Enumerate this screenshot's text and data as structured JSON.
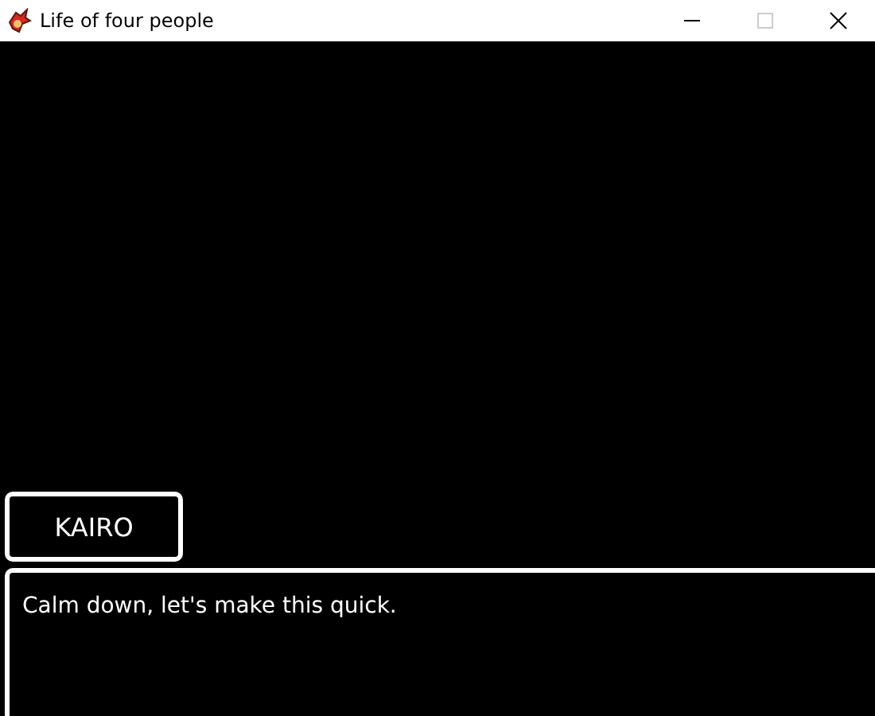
{
  "window": {
    "title": "Life of four people"
  },
  "speaker": {
    "name": "KAIRO"
  },
  "dialogue": {
    "text": "Calm down, let's make this quick."
  }
}
